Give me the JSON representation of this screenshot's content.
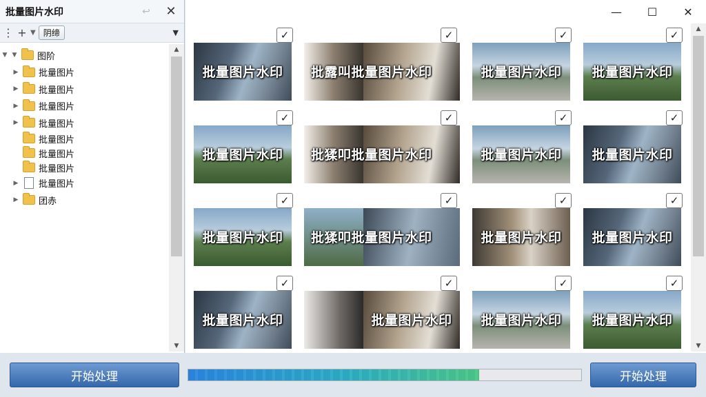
{
  "left_panel": {
    "title": "批量图片水印",
    "toolbar": {
      "path_label": "阴缔"
    },
    "tree": {
      "root": "图阶",
      "items": [
        {
          "label": "批量图片",
          "expander": "▶",
          "icon": "folder-icon"
        },
        {
          "label": "批量图片",
          "expander": "▶",
          "icon": "folder-icon"
        },
        {
          "label": "批量图片",
          "expander": "▶",
          "icon": "folder-icon"
        },
        {
          "label": "批量图片",
          "expander": "▶",
          "icon": "folder-icon"
        },
        {
          "label": "批量图片",
          "expander": "",
          "icon": "folder-icon"
        },
        {
          "label": "批量图片",
          "expander": "",
          "icon": "folder-icon"
        },
        {
          "label": "批量图片",
          "expander": "",
          "icon": "folder-icon"
        },
        {
          "label": "批量图片",
          "expander": "▶",
          "icon": "document-icon"
        },
        {
          "label": "团赤",
          "expander": "▶",
          "icon": "folder-icon"
        }
      ]
    }
  },
  "thumbnails": {
    "watermark_text": "批量图片水印",
    "wide_prefix_a": "批露叫",
    "wide_prefix_b": "批猱叩"
  },
  "footer": {
    "left_button": "开始处理",
    "right_button": "开始处理",
    "progress_percent": 74
  }
}
